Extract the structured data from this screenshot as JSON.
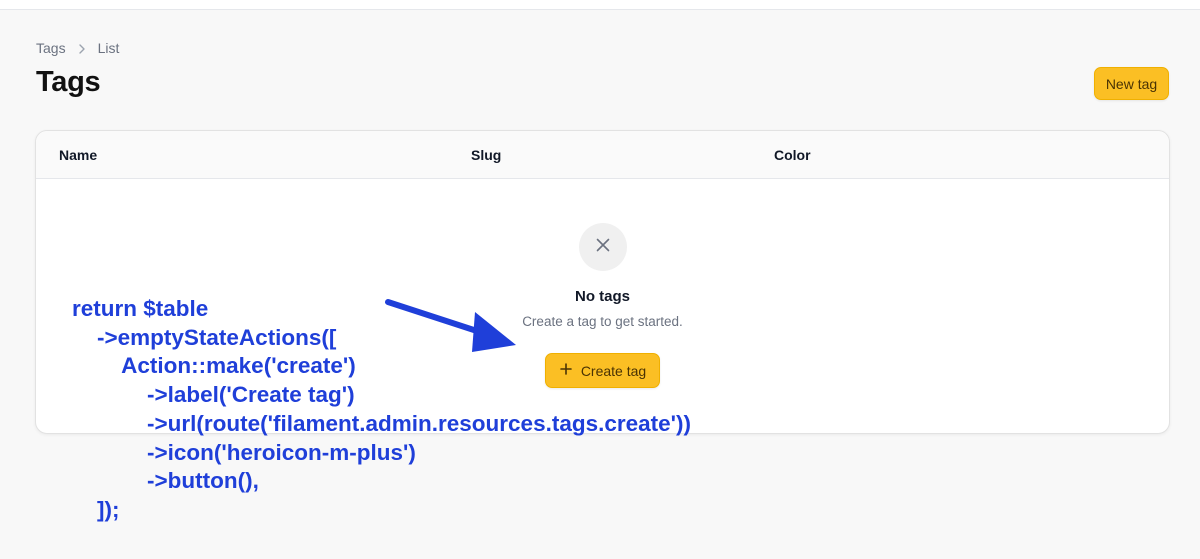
{
  "breadcrumb": {
    "items": [
      "Tags",
      "List"
    ]
  },
  "header": {
    "title": "Tags",
    "new_button_label": "New tag"
  },
  "table": {
    "columns": [
      "Name",
      "Slug",
      "Color"
    ],
    "empty_state": {
      "icon": "x-mark-icon",
      "heading": "No tags",
      "description": "Create a tag to get started.",
      "action_label": "Create tag",
      "action_icon": "plus-icon"
    }
  },
  "annotation": {
    "code_lines": [
      "return $table",
      "    ->emptyStateActions([",
      "        Action::make('create')",
      "            ->label('Create tag')",
      "            ->url(route('filament.admin.resources.tags.create'))",
      "            ->icon('heroicon-m-plus')",
      "            ->button(),",
      "    ]);"
    ],
    "color": "#1f3fd9"
  },
  "colors": {
    "accent": "#fbbf24",
    "page_bg": "#f8f8f8"
  }
}
